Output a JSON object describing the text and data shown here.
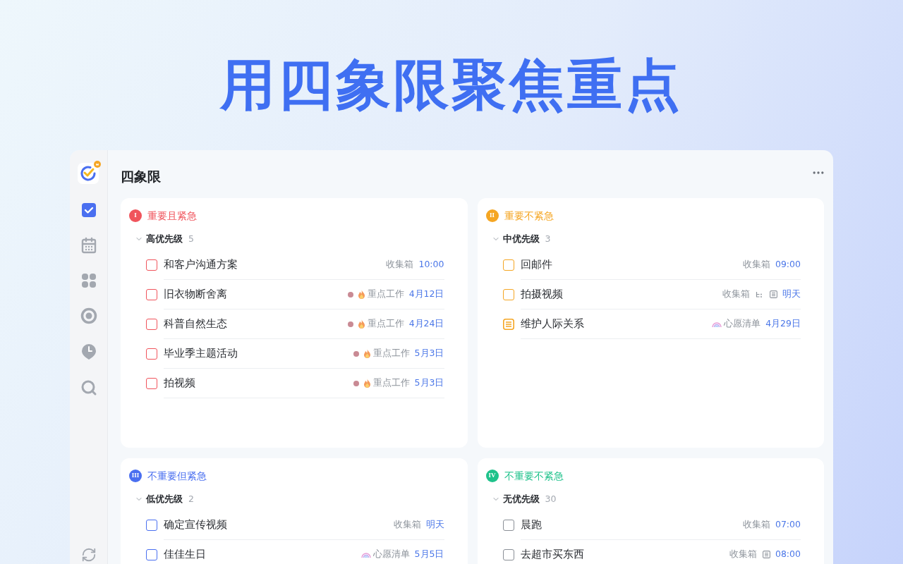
{
  "headline": "用四象限聚焦重点",
  "sidebar": {
    "items": [
      {
        "kind": "tasks",
        "selected": true
      },
      {
        "kind": "calendar",
        "selected": false
      },
      {
        "kind": "matrix",
        "selected": false
      },
      {
        "kind": "focus",
        "selected": false
      },
      {
        "kind": "habit",
        "selected": false
      },
      {
        "kind": "search",
        "selected": false
      }
    ]
  },
  "page_title": "四象限",
  "quadrants": [
    {
      "badge": "I",
      "title": "重要且紧急",
      "color": "#f0545c",
      "group": {
        "label": "高优先级",
        "count": "5",
        "expanded": true
      },
      "tasks": [
        {
          "kind": "checkbox",
          "checked": false,
          "title": "和客户沟通方案",
          "list": {
            "kind": "plain",
            "name": "收集箱"
          },
          "date": "10:00"
        },
        {
          "kind": "checkbox",
          "checked": false,
          "title": "旧衣物断舍离",
          "dot": true,
          "list": {
            "kind": "fire",
            "name": "重点工作"
          },
          "date": "4月12日"
        },
        {
          "kind": "checkbox",
          "checked": false,
          "title": "科普自然生态",
          "dot": true,
          "list": {
            "kind": "fire",
            "name": "重点工作"
          },
          "date": "4月24日"
        },
        {
          "kind": "checkbox",
          "checked": false,
          "title": "毕业季主题活动",
          "dot": true,
          "list": {
            "kind": "fire",
            "name": "重点工作"
          },
          "date": "5月3日"
        },
        {
          "kind": "checkbox",
          "checked": false,
          "title": "拍视频",
          "dot": true,
          "list": {
            "kind": "fire",
            "name": "重点工作"
          },
          "date": "5月3日"
        }
      ]
    },
    {
      "badge": "II",
      "title": "重要不紧急",
      "color": "#f5a623",
      "group": {
        "label": "中优先级",
        "count": "3",
        "expanded": true
      },
      "tasks": [
        {
          "kind": "checkbox",
          "checked": false,
          "title": "回邮件",
          "list": {
            "kind": "plain",
            "name": "收集箱"
          },
          "date": "09:00"
        },
        {
          "kind": "checkbox",
          "checked": false,
          "title": "拍摄视频",
          "list": {
            "kind": "plain",
            "name": "收集箱"
          },
          "subtasks": true,
          "note": true,
          "date": "明天"
        },
        {
          "kind": "note",
          "title": "维护人际关系",
          "list": {
            "kind": "rainbow",
            "name": "心愿清单"
          },
          "date": "4月29日"
        }
      ]
    },
    {
      "badge": "III",
      "title": "不重要但紧急",
      "color": "#4a6ff0",
      "group": {
        "label": "低优先级",
        "count": "2",
        "expanded": true
      },
      "tasks": [
        {
          "kind": "checkbox",
          "checked": false,
          "title": "确定宣传视频",
          "list": {
            "kind": "plain",
            "name": "收集箱"
          },
          "date": "明天"
        },
        {
          "kind": "checkbox",
          "checked": false,
          "title": "佳佳生日",
          "list": {
            "kind": "rainbow",
            "name": "心愿清单"
          },
          "date": "5月5日"
        }
      ]
    },
    {
      "badge": "IV",
      "title": "不重要不紧急",
      "color": "#1fc28b",
      "group": {
        "label": "无优先级",
        "count": "30",
        "expanded": true
      },
      "tasks": [
        {
          "kind": "checkbox",
          "checked": false,
          "title": "晨跑",
          "list": {
            "kind": "plain",
            "name": "收集箱"
          },
          "date": "07:00"
        },
        {
          "kind": "checkbox",
          "checked": false,
          "title": "去超市买东西",
          "list": {
            "kind": "plain",
            "name": "收集箱"
          },
          "note": true,
          "date": "08:00"
        }
      ]
    }
  ]
}
